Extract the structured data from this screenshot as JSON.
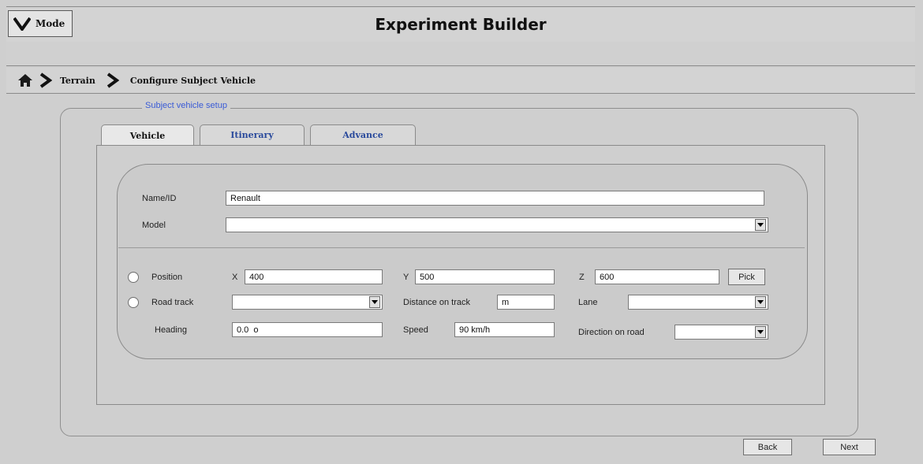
{
  "app": {
    "title": "Experiment Builder",
    "mode_label": "Mode"
  },
  "breadcrumb": {
    "items": [
      "Terrain",
      "Configure Subject Vehicle"
    ]
  },
  "group": {
    "legend": "Subject vehicle setup"
  },
  "tabs": [
    {
      "label": "Vehicle",
      "active": true
    },
    {
      "label": "Itinerary",
      "active": false
    },
    {
      "label": "Advance",
      "active": false
    }
  ],
  "form": {
    "name_label": "Name/ID",
    "name_value": "Renault",
    "model_label": "Model",
    "model_value": "",
    "position_label": "Position",
    "x_label": "X",
    "x_value": "400",
    "y_label": "Y",
    "y_value": "500",
    "z_label": "Z",
    "z_value": "600",
    "pick_label": "Pick",
    "road_track_label": "Road track",
    "road_track_value": "",
    "distance_label": "Distance on track",
    "distance_value": "m",
    "lane_label": "Lane",
    "lane_value": "",
    "heading_label": "Heading",
    "heading_value": "0.0  o",
    "speed_label": "Speed",
    "speed_value": "90 km/h",
    "direction_label": "Direction on road",
    "direction_value": ""
  },
  "nav": {
    "back_label": "Back",
    "next_label": "Next"
  },
  "icons": {
    "mode": "chevron-down-icon",
    "home": "home-icon",
    "separator": "chevron-right-icon"
  }
}
